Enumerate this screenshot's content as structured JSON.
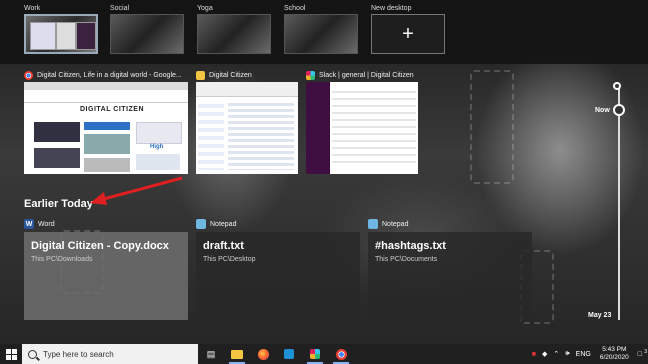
{
  "desktops": [
    {
      "label": "Work",
      "active": true
    },
    {
      "label": "Social",
      "active": false
    },
    {
      "label": "Yoga",
      "active": false
    },
    {
      "label": "School",
      "active": false
    }
  ],
  "new_desktop_label": "New desktop",
  "windows": [
    {
      "title": "Digital Citizen, Life in a digital world - Google...",
      "icon": "chrome-icon",
      "brand": "DIGITAL CITIZEN",
      "price": "High"
    },
    {
      "title": "Digital Citizen",
      "icon": "folder-icon"
    },
    {
      "title": "Slack | general | Digital Citizen",
      "icon": "slack-icon"
    }
  ],
  "section_title": "Earlier Today",
  "activities": [
    {
      "app": "Word",
      "icon_letter": "W",
      "title": "Digital Citizen - Copy.docx",
      "path": "This PC\\Downloads"
    },
    {
      "app": "Notepad",
      "icon_letter": "",
      "title": "draft.txt",
      "path": "This PC\\Desktop"
    },
    {
      "app": "Notepad",
      "icon_letter": "",
      "title": "#hashtags.txt",
      "path": "This PC\\Documents"
    }
  ],
  "timeline": {
    "now": "Now",
    "end": "May 23"
  },
  "taskbar": {
    "search_placeholder": "Type here to search",
    "language": "ENG",
    "time": "5:43 PM",
    "date": "6/20/2020",
    "notifications": "3"
  },
  "colors": {
    "arrow": "#e02020",
    "word": "#2b579a",
    "notepad": "#6fb6e3",
    "chrome": "#4285f4"
  }
}
